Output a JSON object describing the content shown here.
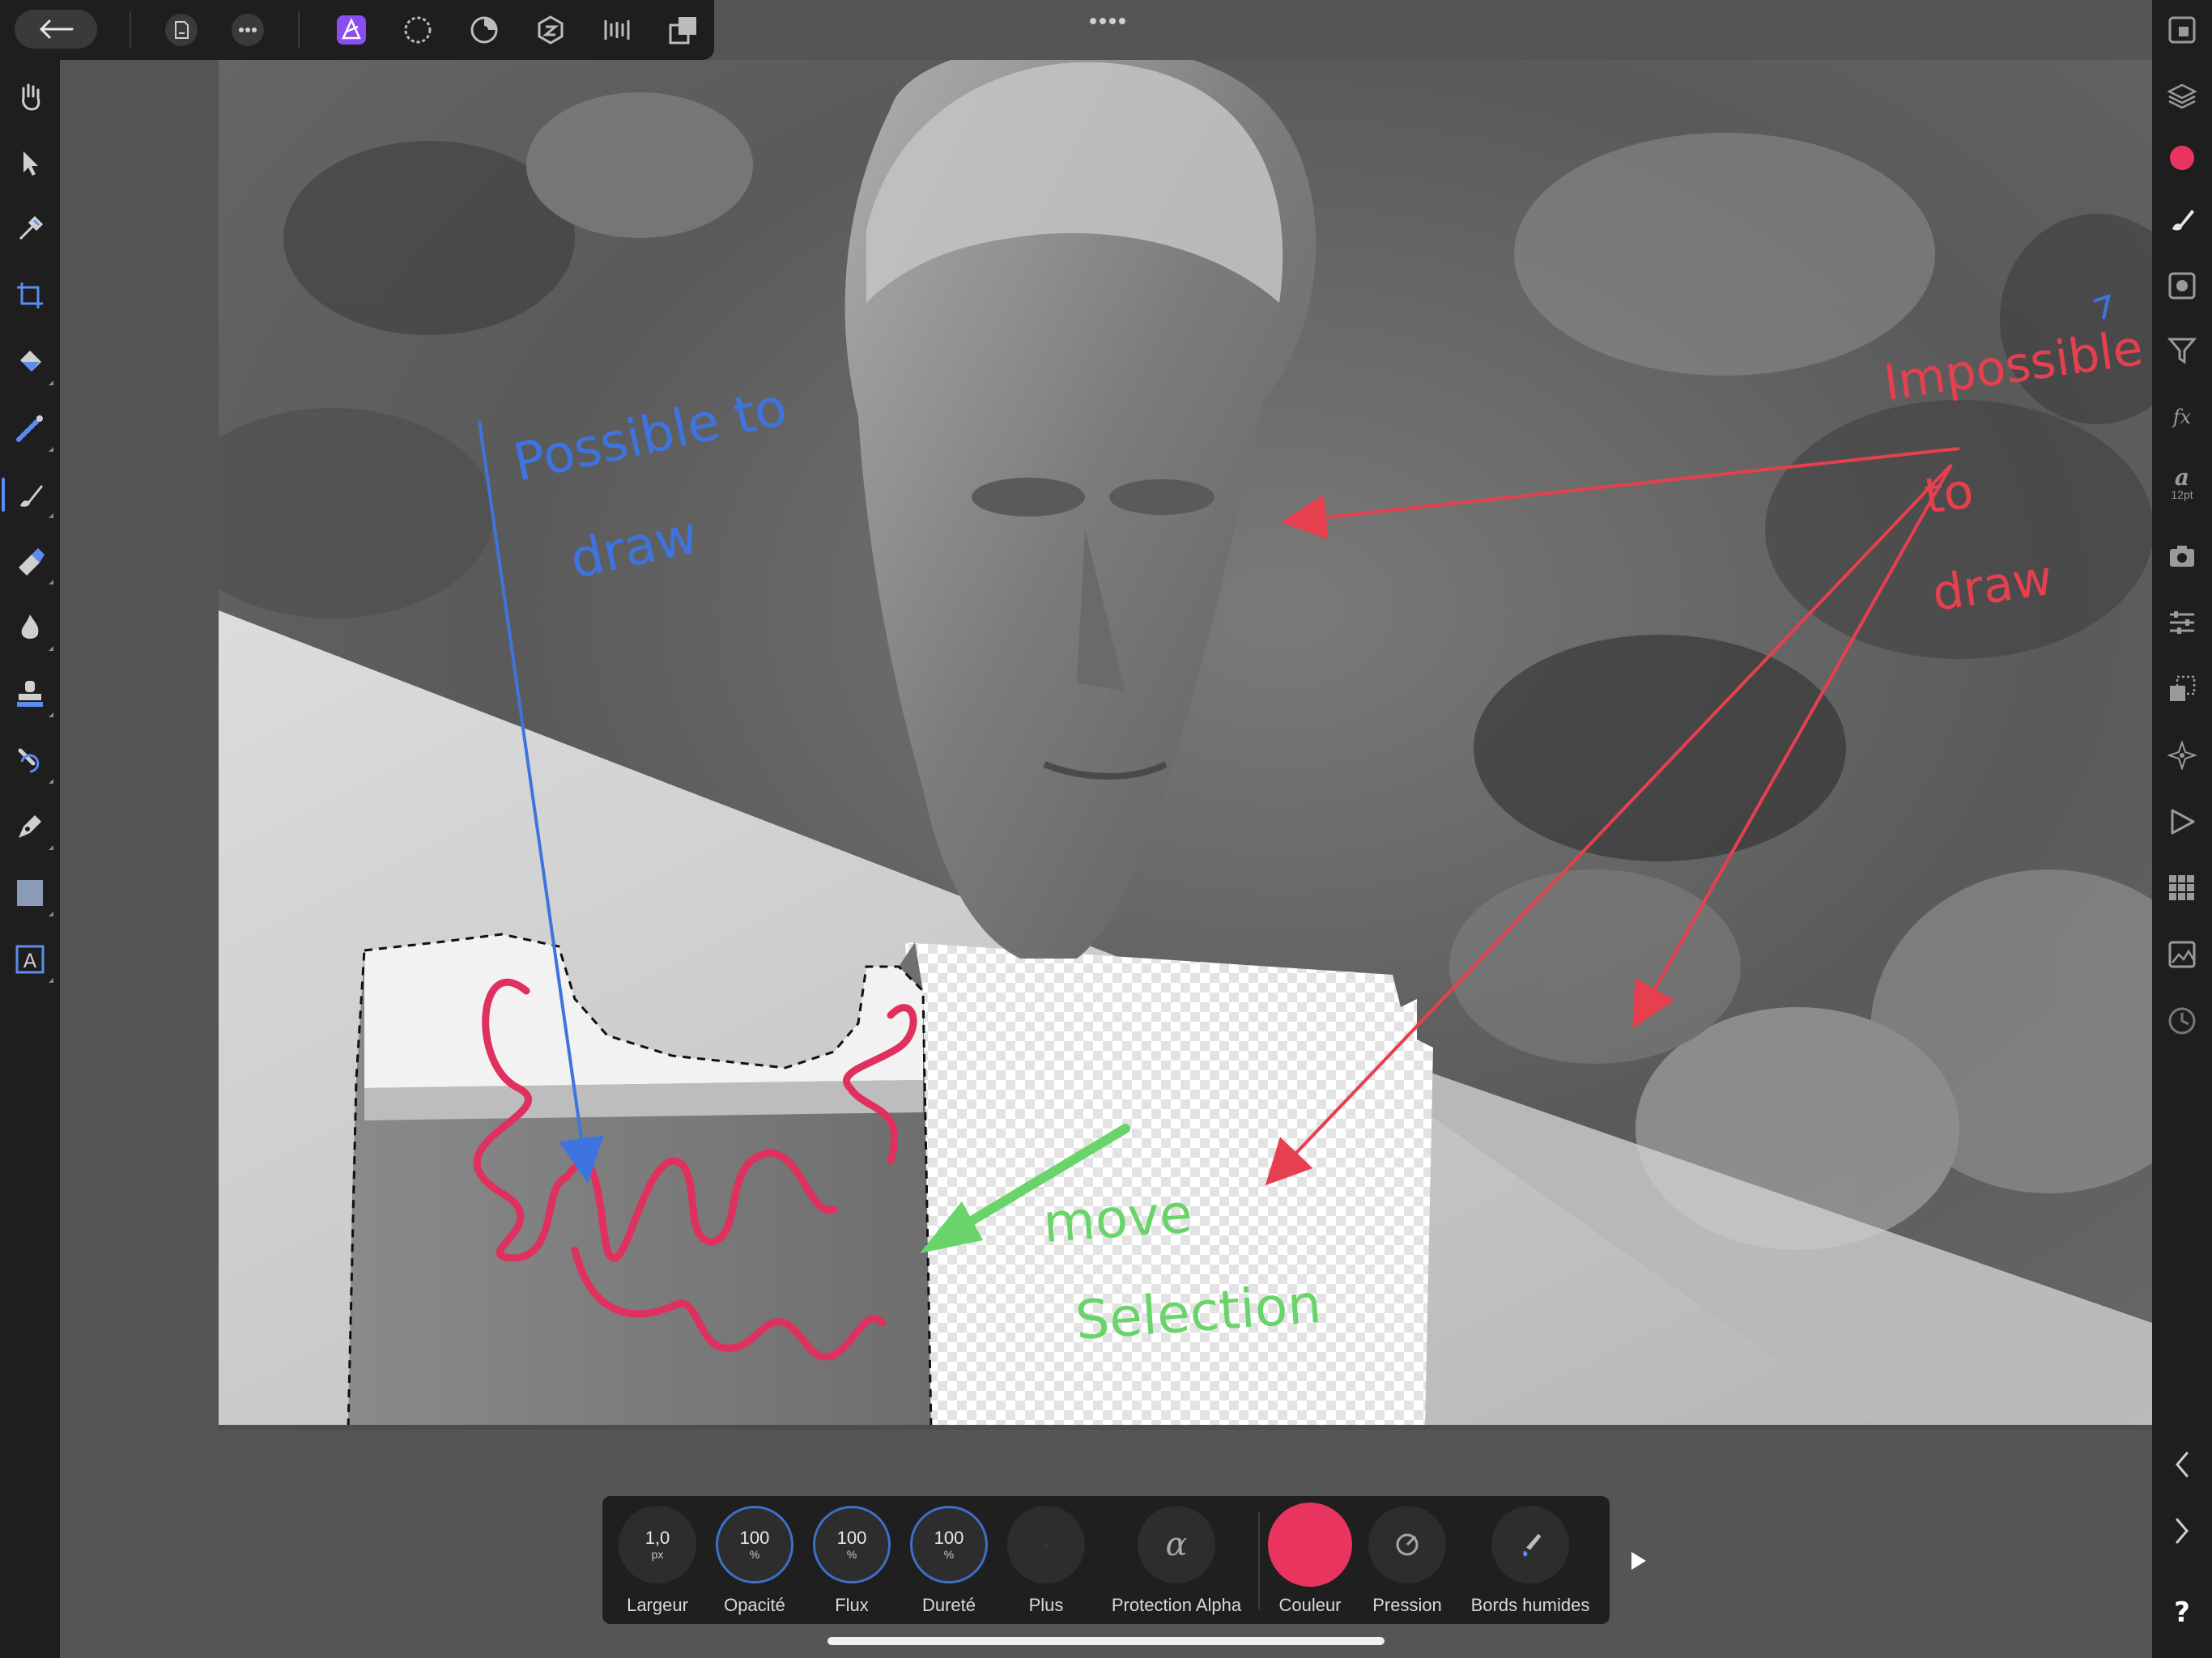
{
  "colors": {
    "accent": "#5a8dee",
    "brush_color": "#e8345f",
    "annotation_blue": "#3e74e0",
    "annotation_red": "#e6404f",
    "annotation_green": "#68d46a",
    "scribble_pink": "#e0305e",
    "app_purple": "#8a4ef0"
  },
  "top_bar": {
    "icons": [
      "back-arrow-icon",
      "document-icon",
      "more-icon",
      "photo-persona-icon",
      "liquify-persona-icon",
      "develop-persona-icon",
      "tone-mapping-persona-icon",
      "export-persona-icon",
      "arrange-icon"
    ]
  },
  "left_tools": [
    "hand-icon",
    "move-icon",
    "color-picker-icon",
    "crop-icon",
    "flood-fill-icon",
    "selection-brush-icon",
    "paint-brush-icon",
    "erase-brush-icon",
    "dodge-burn-icon",
    "clone-icon",
    "inpainting-icon",
    "pen-icon",
    "shape-icon",
    "text-icon"
  ],
  "right_studio": {
    "text_style_size": "12pt"
  },
  "annotations": {
    "possible": "Possible to draw",
    "impossible": "Impossible to draw",
    "move_selection": "move Selection"
  },
  "context_toolbar": {
    "width": {
      "value": "1,0",
      "unit": "px",
      "label": "Largeur"
    },
    "opacity": {
      "value": "100",
      "unit": "%",
      "label": "Opacité"
    },
    "flow": {
      "value": "100",
      "unit": "%",
      "label": "Flux"
    },
    "hardness": {
      "value": "100",
      "unit": "%",
      "label": "Dureté"
    },
    "more": {
      "label": "Plus"
    },
    "protect_alpha": {
      "symbol": "α",
      "label": "Protection Alpha"
    },
    "color": {
      "label": "Couleur"
    },
    "pressure": {
      "label": "Pression"
    },
    "wet_edges": {
      "label": "Bords humides"
    }
  }
}
